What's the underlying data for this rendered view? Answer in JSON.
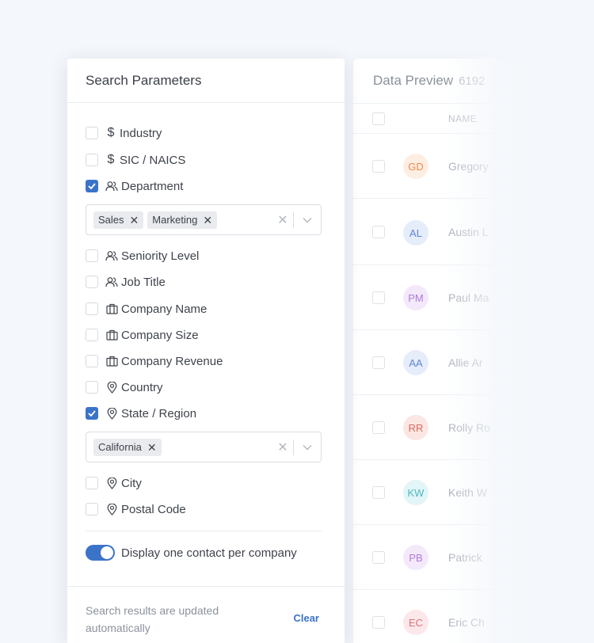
{
  "preview": {
    "title": "Data Preview",
    "count": "6192",
    "column_name": "NAME",
    "rows": [
      {
        "initials": "GD",
        "name": "Gregory",
        "color": "#f08a4b",
        "bg": "#fdeee3"
      },
      {
        "initials": "AL",
        "name": "Austin L",
        "color": "#5f86d6",
        "bg": "#e6edfa"
      },
      {
        "initials": "PM",
        "name": "Paul Ma",
        "color": "#b07ad8",
        "bg": "#f3e9fb"
      },
      {
        "initials": "AA",
        "name": "Allie Ar",
        "color": "#5f86d6",
        "bg": "#e6edfa"
      },
      {
        "initials": "RR",
        "name": "Rolly Ro",
        "color": "#d96a5e",
        "bg": "#fbe6e3"
      },
      {
        "initials": "KW",
        "name": "Keith W",
        "color": "#4fb6c4",
        "bg": "#e2f5f7"
      },
      {
        "initials": "PB",
        "name": "Patrick",
        "color": "#b07ad8",
        "bg": "#f3e9fb"
      },
      {
        "initials": "EC",
        "name": "Eric Ch",
        "color": "#e0707a",
        "bg": "#fce8ea"
      }
    ]
  },
  "panel": {
    "title": "Search Parameters",
    "options": [
      {
        "label": "Industry",
        "icon": "dollar-icon",
        "checked": false
      },
      {
        "label": "SIC / NAICS",
        "icon": "dollar-icon",
        "checked": false
      },
      {
        "label": "Department",
        "icon": "users-icon",
        "checked": true
      },
      {
        "label": "Seniority Level",
        "icon": "users-icon",
        "checked": false
      },
      {
        "label": "Job Title",
        "icon": "users-icon",
        "checked": false
      },
      {
        "label": "Company Name",
        "icon": "briefcase-icon",
        "checked": false
      },
      {
        "label": "Company Size",
        "icon": "briefcase-icon",
        "checked": false
      },
      {
        "label": "Company Revenue",
        "icon": "briefcase-icon",
        "checked": false
      },
      {
        "label": "Country",
        "icon": "location-pin-icon",
        "checked": false
      },
      {
        "label": "State / Region",
        "icon": "location-pin-icon",
        "checked": true
      },
      {
        "label": "City",
        "icon": "location-pin-icon",
        "checked": false
      },
      {
        "label": "Postal Code",
        "icon": "location-pin-icon",
        "checked": false
      }
    ],
    "department_tags": [
      "Sales",
      "Marketing"
    ],
    "state_tags": [
      "California"
    ],
    "toggle_label": "Display one contact per company",
    "toggle_on": true,
    "footer_note": "Search results are updated automatically",
    "clear_label": "Clear",
    "accent": "#3b73c9"
  }
}
